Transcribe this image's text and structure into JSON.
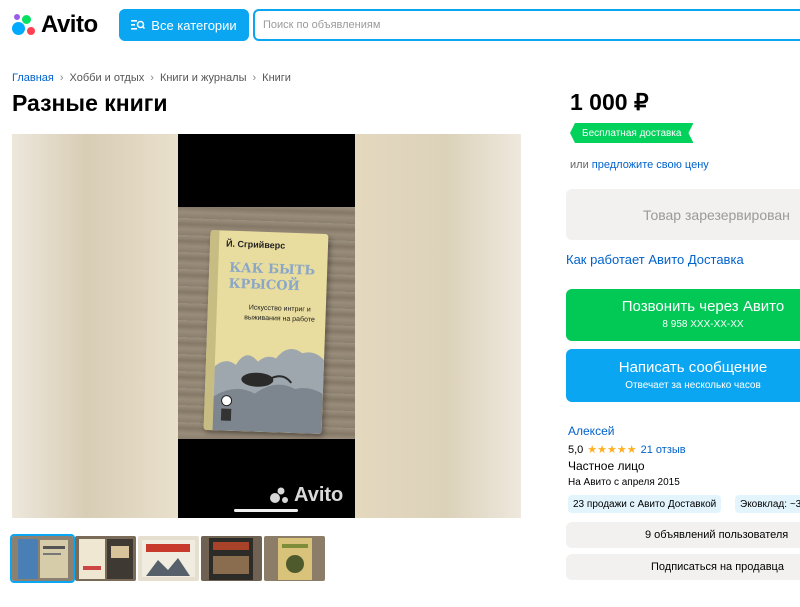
{
  "header": {
    "logo_text": "Avito",
    "categories_label": "Все категории",
    "search_placeholder": "Поиск по объявлениям"
  },
  "breadcrumb": [
    "Главная",
    "Хобби и отдых",
    "Книги и журналы",
    "Книги"
  ],
  "listing": {
    "title": "Разные книги",
    "watermark": "Avito",
    "book": {
      "author": "Й. Сгрийверс",
      "title": "КАК БЫТЬ КРЫСОЙ",
      "subtitle": "Искусство интриг и выживания на работе"
    }
  },
  "sidebar": {
    "price": "1 000 ₽",
    "delivery_badge": "Бесплатная доставка",
    "offer_prefix": "или",
    "offer_link": "предложите свою цену",
    "reserved_label": "Товар зарезервирован",
    "delivery_info_link": "Как работает Авито Доставка",
    "call_button": {
      "label": "Позвонить через Авито",
      "phone": "8 958 XXX-XX-XX"
    },
    "message_button": {
      "label": "Написать сообщение",
      "note": "Отвечает за несколько часов"
    }
  },
  "seller": {
    "name": "Алексей",
    "rating": "5,0",
    "stars": "★★★★★",
    "reviews": "21 отзыв",
    "type": "Частное лицо",
    "since": "На Авито с апреля 2015",
    "tags": [
      "23 продажи с Авито Доставкой",
      "Эковклад: ~3"
    ],
    "listings_button": "9 объявлений пользователя",
    "subscribe_button": "Подписаться на продавца"
  },
  "thumbnails": [
    {
      "label": "thumb-1",
      "colors": [
        "#3d7fb8",
        "#c9b98f"
      ]
    },
    {
      "label": "thumb-2",
      "colors": [
        "#5b4a3a",
        "#e0d8c6"
      ]
    },
    {
      "label": "thumb-3",
      "colors": [
        "#c83a2b",
        "#e8e2d4"
      ]
    },
    {
      "label": "thumb-4",
      "colors": [
        "#a8432a",
        "#2b2b2b"
      ]
    },
    {
      "label": "thumb-5",
      "colors": [
        "#7d8d3a",
        "#d9c27a"
      ]
    }
  ],
  "colors": {
    "brand_blue": "#0ba6f2",
    "brand_green": "#02c956",
    "link": "#0062cc",
    "logo_dots": [
      "#04e061",
      "#ff4053",
      "#965eeb",
      "#0af"
    ]
  }
}
